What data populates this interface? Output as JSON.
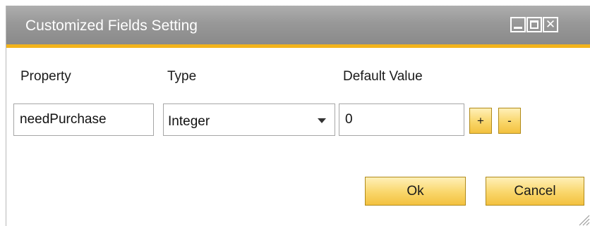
{
  "window": {
    "title": "Customized Fields Setting",
    "controls": {
      "minimize": "minimize-icon",
      "maximize": "maximize-icon",
      "close": "close-icon",
      "close_glyph": "✕"
    }
  },
  "columns": {
    "property": "Property",
    "type": "Type",
    "default_value": "Default Value"
  },
  "row": {
    "property_value": "needPurchase",
    "type_value": "Integer",
    "default_value": "0",
    "add_label": "+",
    "remove_label": "-"
  },
  "buttons": {
    "ok_label": "Ok",
    "cancel_label": "Cancel"
  },
  "colors": {
    "accent": "#f2b31b",
    "title_bar": "#999999",
    "button": "#f9d66a"
  },
  "icons": {
    "dropdown": "chevron-down-icon",
    "resize": "resize-grip-icon"
  }
}
